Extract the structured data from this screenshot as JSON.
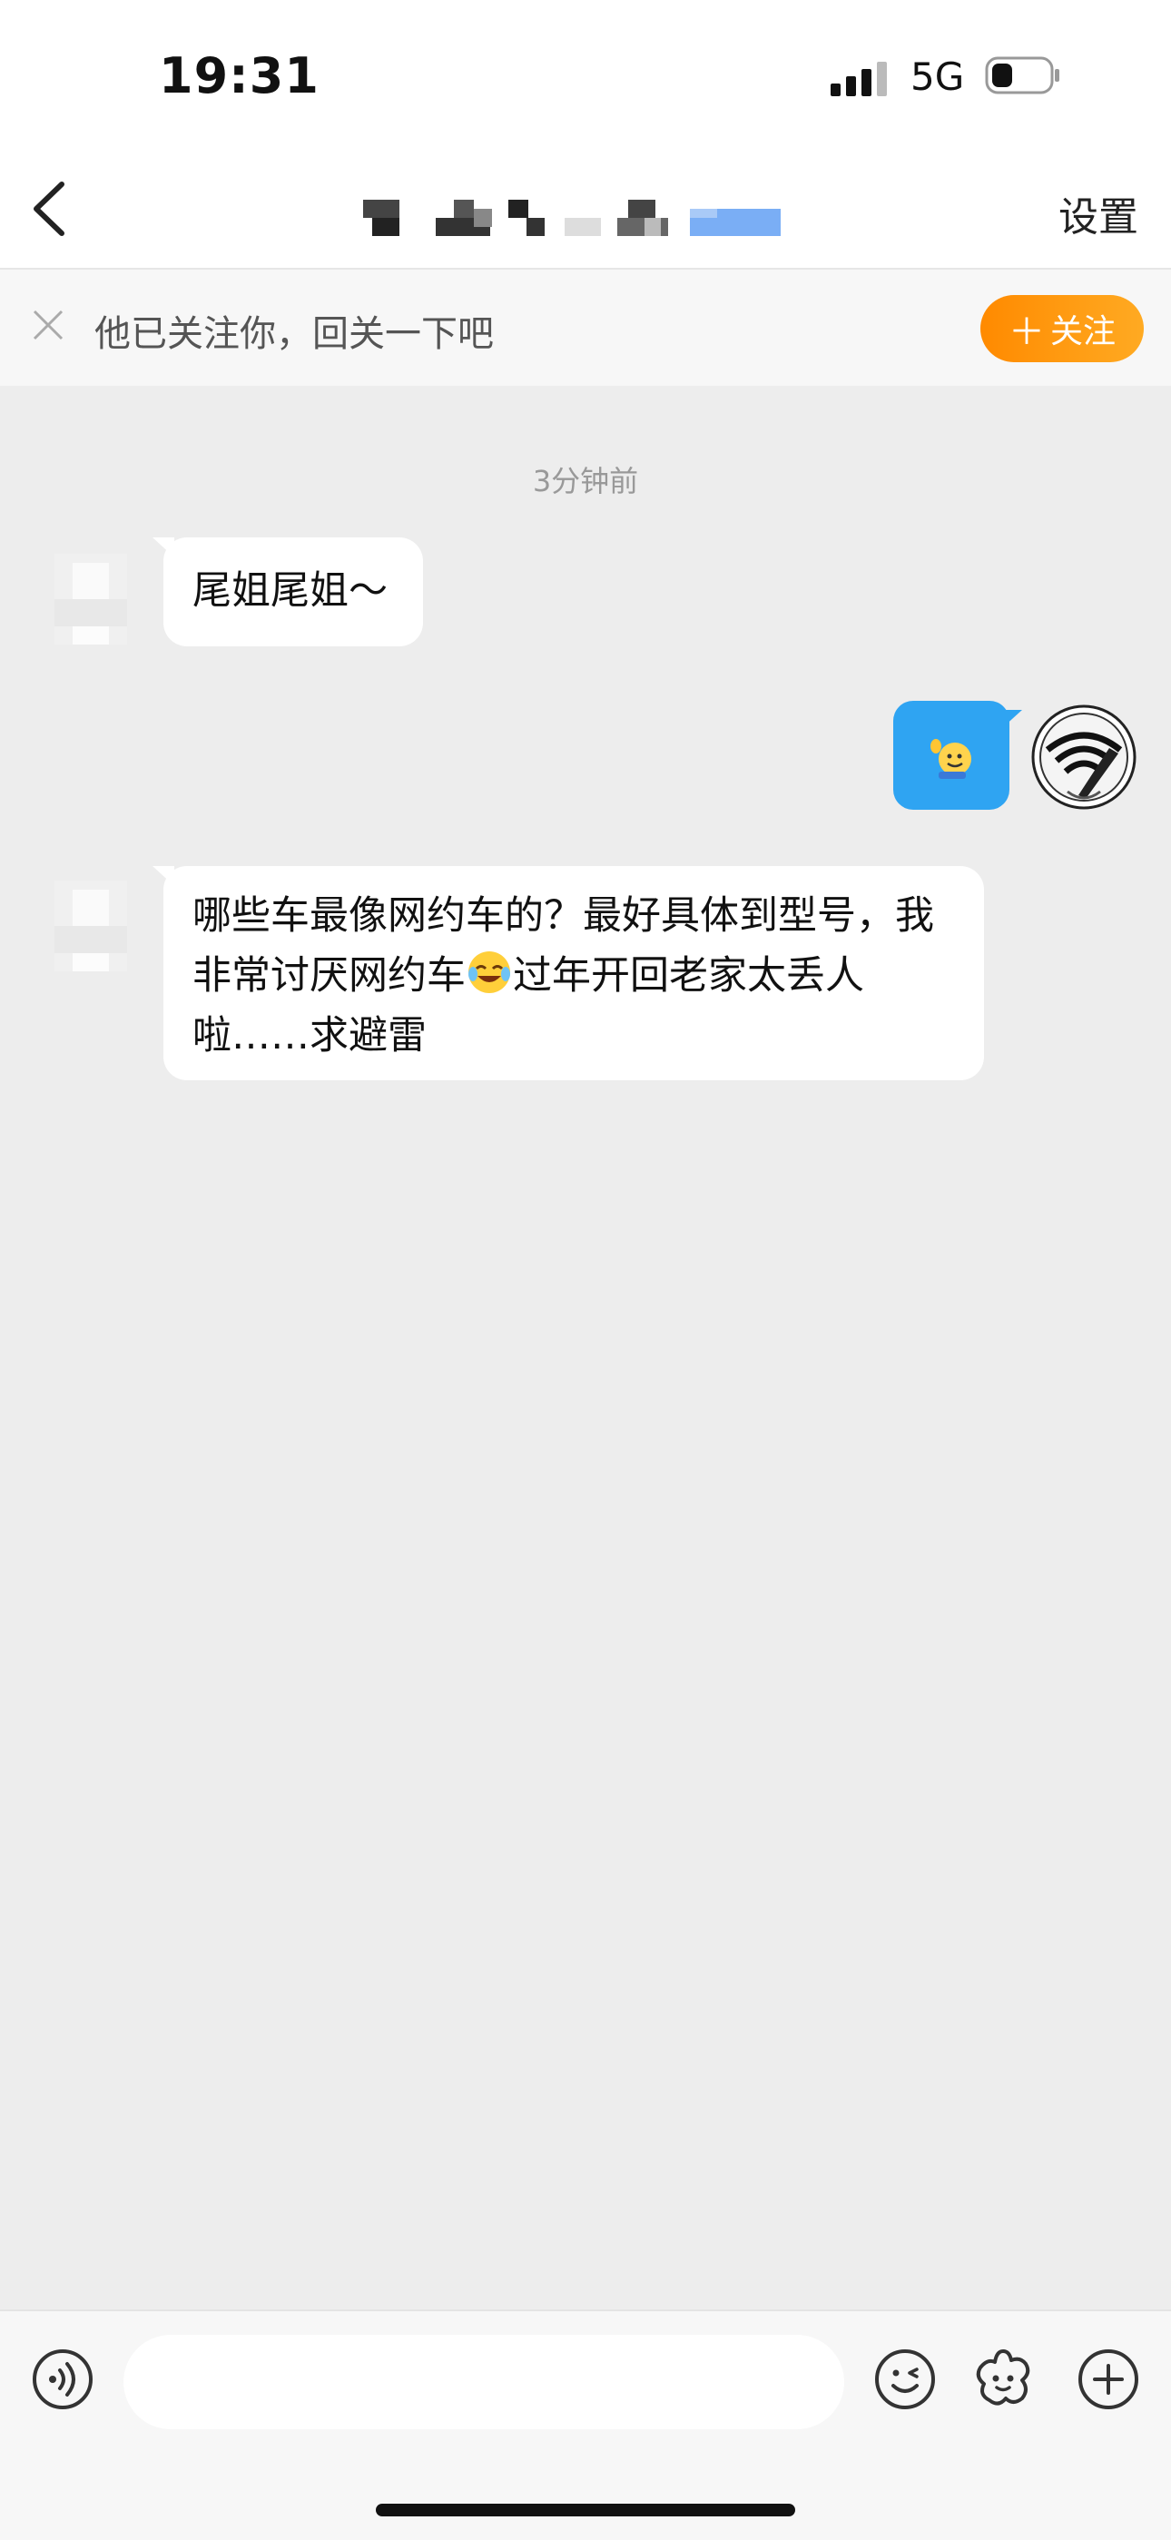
{
  "status_bar": {
    "time": "19:31",
    "network": "5G",
    "icons": [
      "signal-icon",
      "battery-icon"
    ]
  },
  "nav": {
    "back_icon": "chevron-left-icon",
    "settings_label": "设置"
  },
  "follow_bar": {
    "close_icon": "close-icon",
    "text": "他已关注你，回关一下吧",
    "button_label": "关注",
    "button_icon": "plus-icon",
    "accent": "#ff9a10"
  },
  "chat": {
    "timestamp": "3分钟前",
    "messages": [
      {
        "side": "left",
        "text": "尾姐尾姐～"
      },
      {
        "side": "right",
        "content": "waving-emoji-sticker",
        "color": "#2fa4f2"
      },
      {
        "side": "left",
        "text_parts": [
          "哪些车最像网约车的？最好具体到型号，我非常讨厌网约车",
          "过年开回老家太丢人啦……求避雷"
        ],
        "inline_emoji": "crying-laughing-emoji"
      }
    ]
  },
  "input_bar": {
    "icons": [
      "voice-icon",
      "emoji-icon",
      "sticker-icon",
      "plus-circle-icon"
    ]
  }
}
